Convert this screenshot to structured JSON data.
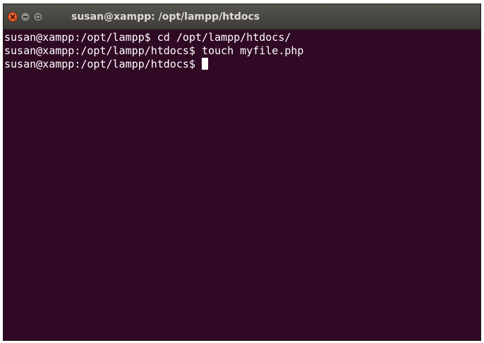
{
  "window": {
    "title": "susan@xampp: /opt/lampp/htdocs",
    "controls": {
      "close": "close-icon",
      "minimize": "minimize-icon",
      "maximize": "maximize-icon"
    }
  },
  "terminal": {
    "lines": [
      "susan@xampp:/opt/lampp$ cd /opt/lampp/htdocs/",
      "susan@xampp:/opt/lampp/htdocs$ touch myfile.php",
      "susan@xampp:/opt/lampp/htdocs$ "
    ]
  },
  "colors": {
    "terminal_background": "#300a24",
    "terminal_text": "#ffffff",
    "titlebar": "#3e3d39",
    "close_button": "#dc4918"
  }
}
